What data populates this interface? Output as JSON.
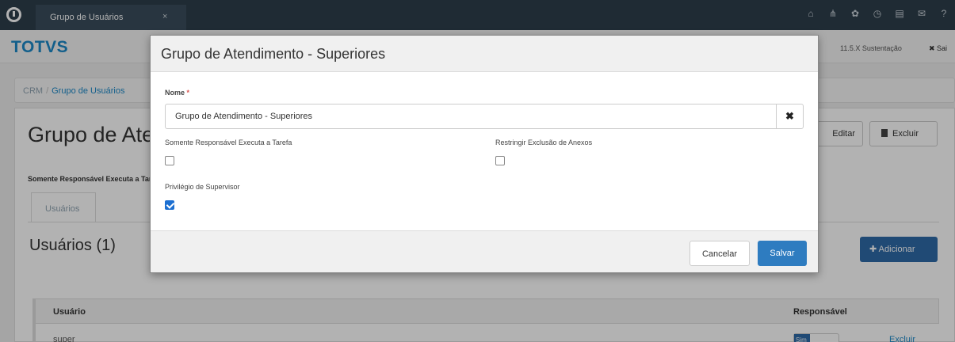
{
  "topbar": {
    "tab_label": "Grupo de Usuários",
    "tab_close": "×",
    "icons": [
      "home-icon",
      "sitemap-icon",
      "settings-icon",
      "clock-icon",
      "document-icon",
      "mail-icon",
      "help-icon"
    ]
  },
  "header": {
    "brand": "TOTVS",
    "env_label": "11.5.X Sustentação",
    "exit_label": "✖ Sai"
  },
  "breadcrumb": {
    "root": "CRM",
    "separator": "/",
    "page": "Grupo de Usuários"
  },
  "page": {
    "title": "Grupo de Atendimento - Superiores",
    "edit_label": "Editar",
    "delete_label": "Excluir",
    "responsible_label": "Somente Responsável Executa a Tarefa",
    "tab_label": "Usuários",
    "section_title": "Usuários (1)",
    "add_label": "Adicionar",
    "table": {
      "headers": [
        "Usuário",
        "Responsável"
      ],
      "rows": [
        {
          "user": "super",
          "responsible": "Sim",
          "action": "Excluir"
        }
      ]
    }
  },
  "modal": {
    "title": "Grupo de Atendimento - Superiores",
    "name_label": "Nome",
    "required_mark": "*",
    "name_value": "Grupo de Atendimento - Superiores",
    "clear_icon": "✖",
    "only_responsible_label": "Somente Responsável Executa a Tarefa",
    "only_responsible_checked": false,
    "restrict_delete_label": "Restringir Exclusão de Anexos",
    "restrict_delete_checked": false,
    "supervisor_label": "Privilégio de Supervisor",
    "supervisor_checked": true,
    "cancel_label": "Cancelar",
    "save_label": "Salvar"
  },
  "colors": {
    "topbar": "#2d3e4b",
    "brand": "#1c89c8",
    "primary_button": "#2e7cc0"
  }
}
